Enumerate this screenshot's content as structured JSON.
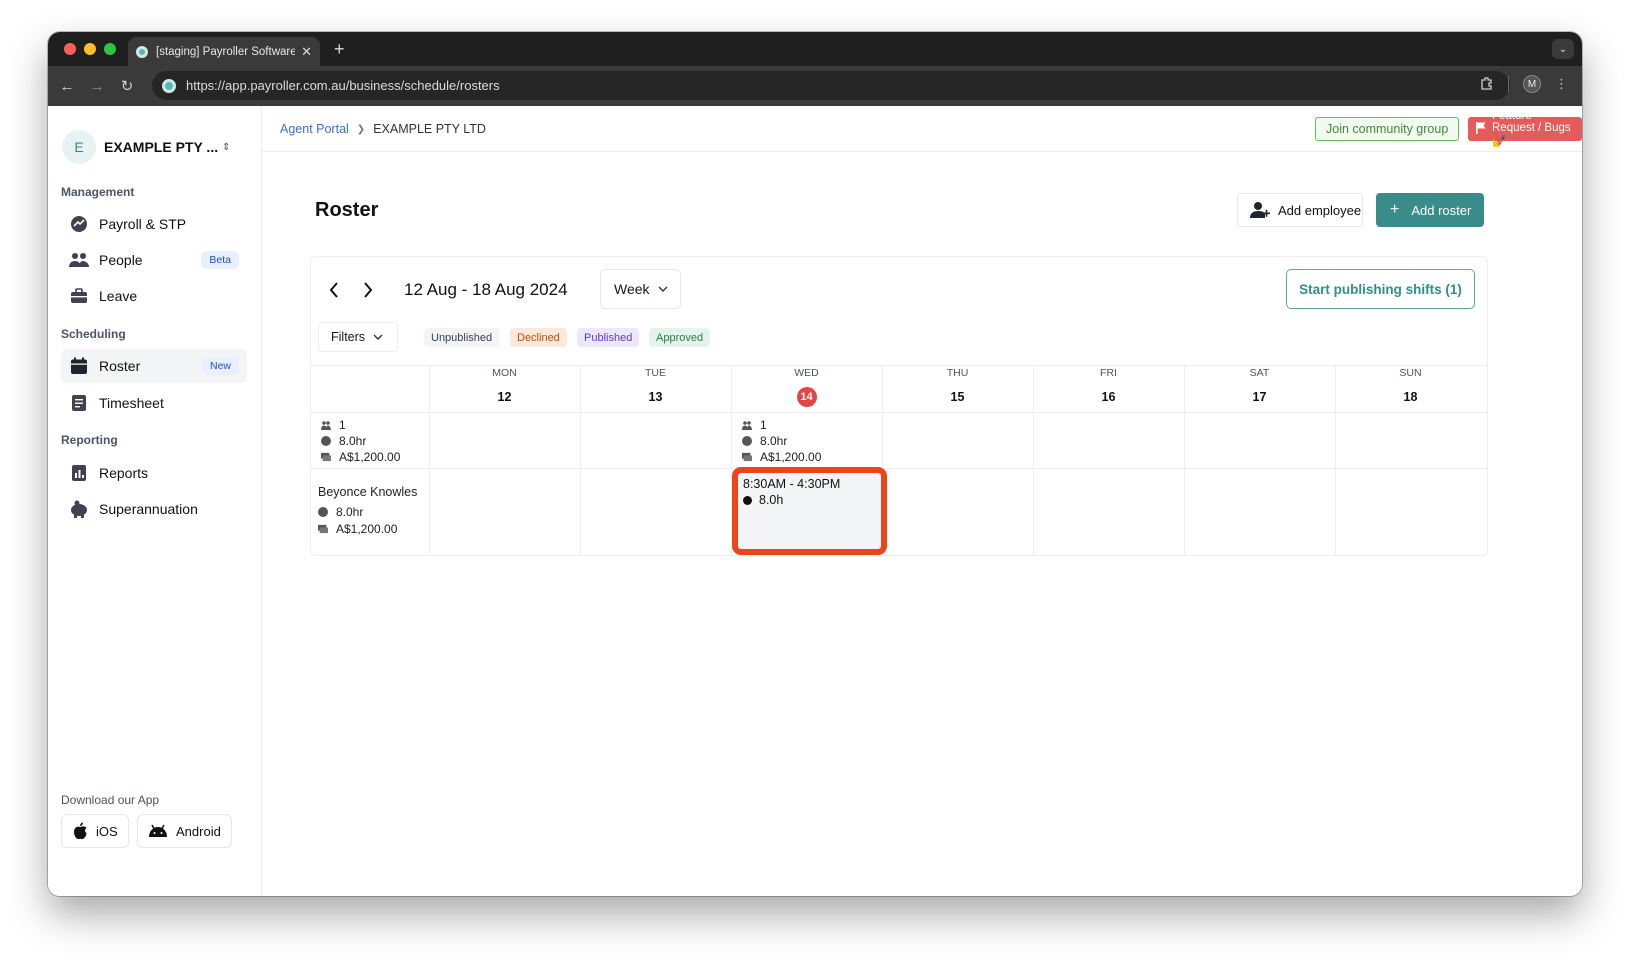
{
  "browser": {
    "tab_title": "[staging] Payroller Software —",
    "tab_close_icon": "close-icon",
    "url": "https://app.payroller.com.au/business/schedule/rosters",
    "profile_initial": "M"
  },
  "sidebar": {
    "business_initial": "E",
    "business_name": "EXAMPLE PTY ...",
    "sections": {
      "management": "Management",
      "scheduling": "Scheduling",
      "reporting": "Reporting"
    },
    "items": {
      "payroll": "Payroll & STP",
      "people": "People",
      "people_badge": "Beta",
      "leave": "Leave",
      "roster": "Roster",
      "roster_badge": "New",
      "timesheet": "Timesheet",
      "reports": "Reports",
      "superannuation": "Superannuation"
    },
    "download_label": "Download our App",
    "ios_label": "iOS",
    "android_label": "Android"
  },
  "header": {
    "breadcrumb_link": "Agent Portal",
    "breadcrumb_current": "EXAMPLE PTY LTD",
    "join_label": "Join community group",
    "feature_label": "Feature Request / Bugs 💅"
  },
  "page": {
    "title": "Roster",
    "add_employee_label": "Add employee",
    "add_roster_label": "Add roster"
  },
  "roster": {
    "date_range": "12 Aug - 18 Aug 2024",
    "view": "Week",
    "publish_label": "Start publishing shifts (1)",
    "filters_label": "Filters",
    "statuses": [
      {
        "label": "Unpublished",
        "bg": "#f3f4f6",
        "fg": "#374151"
      },
      {
        "label": "Declined",
        "bg": "#fde8dc",
        "fg": "#b45309"
      },
      {
        "label": "Published",
        "bg": "#ece7fb",
        "fg": "#5b3cc4"
      },
      {
        "label": "Approved",
        "bg": "#e3f5ea",
        "fg": "#2f7a4a"
      }
    ],
    "days": [
      {
        "name": "MON",
        "num": "12"
      },
      {
        "name": "TUE",
        "num": "13"
      },
      {
        "name": "WED",
        "num": "14"
      },
      {
        "name": "THU",
        "num": "15"
      },
      {
        "name": "FRI",
        "num": "16"
      },
      {
        "name": "SAT",
        "num": "17"
      },
      {
        "name": "SUN",
        "num": "18"
      }
    ],
    "totals": {
      "employees": "1",
      "hours": "8.0hr",
      "cost": "A$1,200.00"
    },
    "wed_totals": {
      "employees": "1",
      "hours": "8.0hr",
      "cost": "A$1,200.00"
    },
    "employee": {
      "name": "Beyonce Knowles",
      "hours": "8.0hr",
      "cost": "A$1,200.00"
    },
    "shift": {
      "time": "8:30AM - 4:30PM",
      "hours": "8.0h"
    }
  }
}
